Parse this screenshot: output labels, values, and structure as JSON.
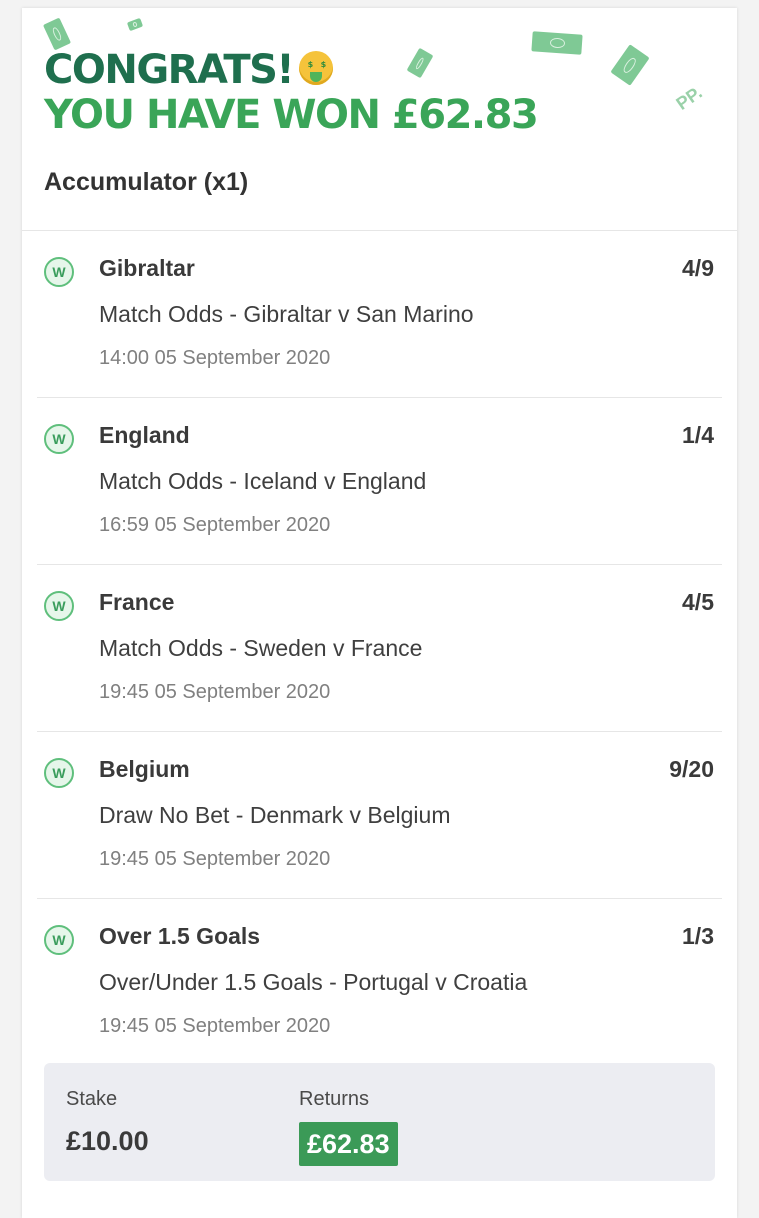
{
  "header": {
    "congrats": "CONGRATS!",
    "won_prefix": "YOU HAVE WON",
    "won_amount": "£62.83",
    "emoji_icon": "money-mouth-face-icon",
    "brand_mark": "PP.",
    "bet_type": "Accumulator (x1)"
  },
  "colors": {
    "dark_green": "#1f6f4e",
    "bright_green": "#3aa558",
    "win_badge": "#5fbf7c",
    "returns_bg": "#3b9a57"
  },
  "legs": [
    {
      "status": "W",
      "selection": "Gibraltar",
      "odds": "4/9",
      "market": "Match Odds - Gibraltar v San Marino",
      "time": "14:00 05 September 2020"
    },
    {
      "status": "W",
      "selection": "England",
      "odds": "1/4",
      "market": "Match Odds - Iceland v England",
      "time": "16:59 05 September 2020"
    },
    {
      "status": "W",
      "selection": "France",
      "odds": "4/5",
      "market": "Match Odds - Sweden v France",
      "time": "19:45 05 September 2020"
    },
    {
      "status": "W",
      "selection": "Belgium",
      "odds": "9/20",
      "market": "Draw No Bet - Denmark v Belgium",
      "time": "19:45 05 September 2020"
    },
    {
      "status": "W",
      "selection": "Over 1.5 Goals",
      "odds": "1/3",
      "market": "Over/Under 1.5 Goals - Portugal v Croatia",
      "time": "19:45 05 September 2020"
    }
  ],
  "totals": {
    "stake_label": "Stake",
    "stake_value": "£10.00",
    "returns_label": "Returns",
    "returns_value": "£62.83"
  }
}
